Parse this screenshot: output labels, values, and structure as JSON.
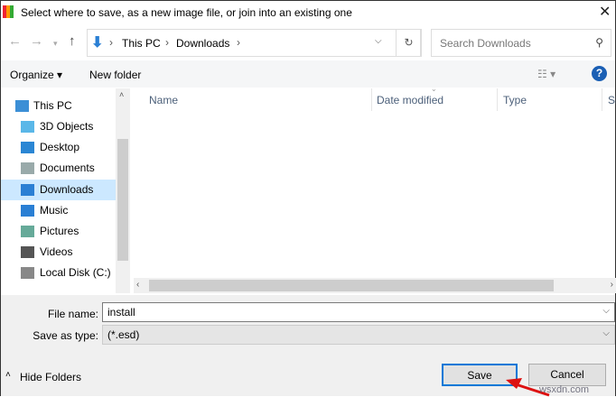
{
  "window": {
    "title": "Select where to save, as a new image file, or join into an existing one"
  },
  "nav": {
    "breadcrumb": [
      "This PC",
      "Downloads"
    ],
    "search_placeholder": "Search Downloads"
  },
  "toolbar": {
    "organize": "Organize ▾",
    "new_folder": "New folder"
  },
  "sidebar": {
    "items": [
      {
        "label": "This PC",
        "icon": "computer-icon",
        "color": "#3c8fd6"
      },
      {
        "label": "3D Objects",
        "icon": "cube-icon",
        "color": "#5ab7e8"
      },
      {
        "label": "Desktop",
        "icon": "desktop-icon",
        "color": "#2a86d4"
      },
      {
        "label": "Documents",
        "icon": "document-icon",
        "color": "#9aa"
      },
      {
        "label": "Downloads",
        "icon": "download-icon",
        "color": "#2a7fd4"
      },
      {
        "label": "Music",
        "icon": "music-icon",
        "color": "#2a7fd4"
      },
      {
        "label": "Pictures",
        "icon": "pictures-icon",
        "color": "#6a9"
      },
      {
        "label": "Videos",
        "icon": "videos-icon",
        "color": "#555"
      },
      {
        "label": "Local Disk (C:)",
        "icon": "disk-icon",
        "color": "#888"
      }
    ],
    "selected": "Downloads"
  },
  "columns": [
    "Name",
    "Date modified",
    "Type",
    "Si"
  ],
  "form": {
    "file_name_label": "File name:",
    "file_name": "install",
    "type_label": "Save as type:",
    "type_value": "(*.esd)"
  },
  "footer": {
    "hide_folders": "Hide Folders",
    "save": "Save",
    "cancel": "Cancel",
    "watermark": "wsxdn.com"
  }
}
